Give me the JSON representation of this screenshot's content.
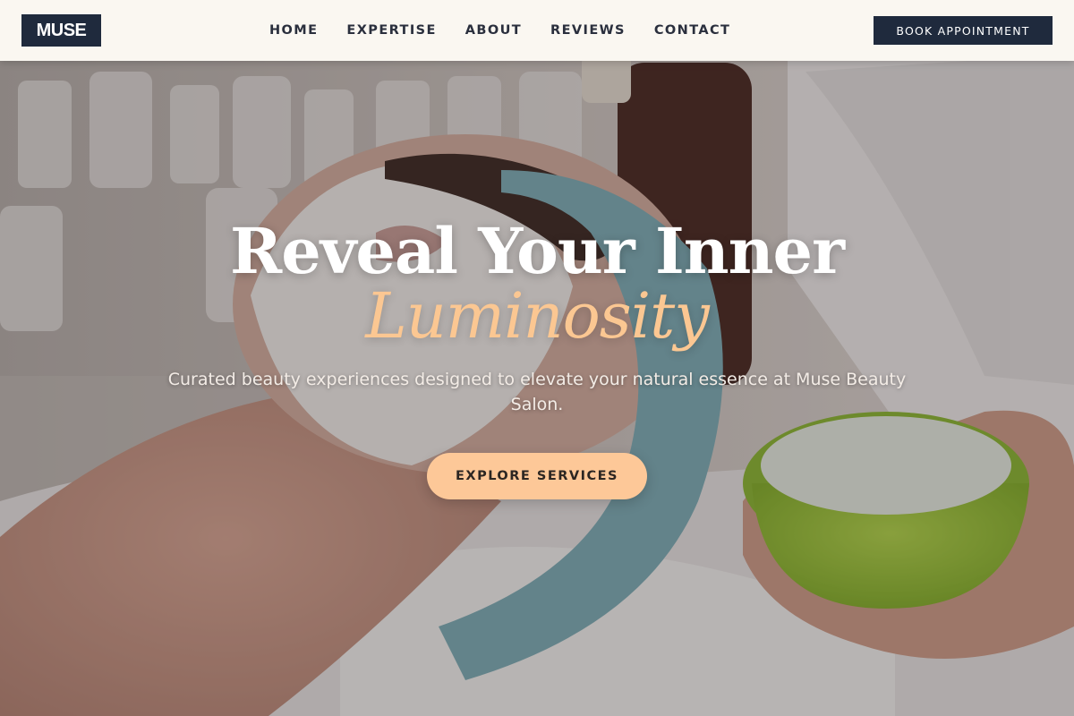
{
  "brand": {
    "logo_text": "MUSE"
  },
  "nav": {
    "items": [
      {
        "label": "HOME"
      },
      {
        "label": "EXPERTISE"
      },
      {
        "label": "ABOUT"
      },
      {
        "label": "REVIEWS"
      },
      {
        "label": "CONTACT"
      }
    ],
    "cta_label": "BOOK APPOINTMENT"
  },
  "hero": {
    "title_line1": "Reveal Your Inner",
    "title_accent": "Luminosity",
    "subtitle": "Curated beauty experiences designed to elevate your natural essence at Muse Beauty Salon.",
    "cta_label": "EXPLORE SERVICES"
  },
  "colors": {
    "navy": "#1f2a3d",
    "header_bg": "#faf7f1",
    "accent_peach": "#fdc898",
    "accent_text": "#fbc792"
  }
}
